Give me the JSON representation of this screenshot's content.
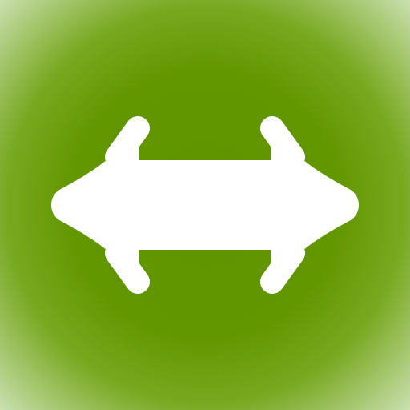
{
  "icon": {
    "name": "double-arrow-icon",
    "symbol": "left-right-arrow",
    "colors": {
      "background_center": "#5e9400",
      "background_mid": "#78a820",
      "background_edge": "#c9dfae",
      "arrow": "#ffffff"
    }
  }
}
